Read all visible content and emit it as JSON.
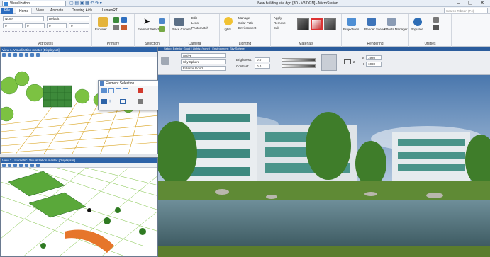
{
  "titlebar": {
    "workspace": "Visualization",
    "title": "New building site.dgn [3D - V8 DGN] - MicroStation",
    "min": "–",
    "max": "▢",
    "close": "✕"
  },
  "tabs": [
    "File",
    "Home",
    "View",
    "Animate",
    "Drawing Aids",
    "LumenRT"
  ],
  "search": {
    "placeholder": "Search Ribbon (F4)"
  },
  "ribbon": {
    "attributes": {
      "label": "Attributes",
      "level": "None",
      "style": "Default",
      "color": "0",
      "weight": "0",
      "linestyle": "0",
      "transp": "0"
    },
    "primary": {
      "label": "Primary",
      "explorer": "Explorer"
    },
    "selection": {
      "label": "Selection",
      "element_selection": "Element Selection"
    },
    "camera": {
      "label": "Camera",
      "place_camera": "Place Camera",
      "edit": "Edit",
      "lens": "Lens",
      "photomatch": "Photomatch"
    },
    "lighting": {
      "label": "Lighting",
      "lights": "Lights",
      "manage": "Manage",
      "solar_path": "Solar Path",
      "environment": "Environment"
    },
    "materials": {
      "label": "Materials",
      "apply": "Apply",
      "remove": "Remove",
      "edit": "Edit"
    },
    "rendering": {
      "label": "Rendering",
      "projections": "Projections",
      "render_scene": "Render Scene",
      "effects_manager": "Effects Manager"
    },
    "utilities": {
      "label": "Utilities",
      "populate": "Populate"
    }
  },
  "views": {
    "view1": {
      "title": "View 1, Visualization master [Displayset]"
    },
    "view2": {
      "title": "View 2 - Isometric, Visualization master [Displayset]"
    }
  },
  "element_selection": {
    "title": "Element Selection"
  },
  "mainview": {
    "header": "Setup: Exterior Good | Lights: (none) | Environment: Sky Sphere",
    "setup_value": "Active",
    "environment_value": "Sky Sphere",
    "quality_value": "Exterior Good",
    "brightness_label": "Brightness:",
    "brightness_value": "0.0",
    "contrast_label": "Contrast:",
    "contrast_value": "0.0",
    "zoom_value": "2",
    "width_value": "1920",
    "height_value": "1080",
    "w_label": "W",
    "h_label": "H"
  }
}
